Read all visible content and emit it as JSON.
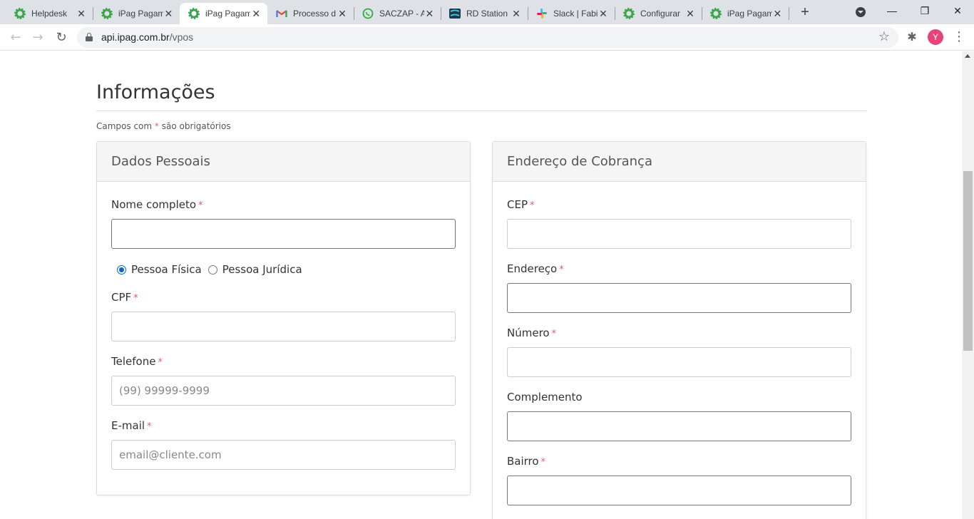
{
  "browser": {
    "tabs": [
      {
        "title": "Helpdesk",
        "icon": "ipag-gear-icon",
        "active": false
      },
      {
        "title": "iPag Pagam",
        "icon": "ipag-gear-icon",
        "active": false
      },
      {
        "title": "iPag Pagam",
        "icon": "ipag-gear-icon",
        "active": true
      },
      {
        "title": "Processo d",
        "icon": "gmail-icon",
        "active": false
      },
      {
        "title": "SACZAP - A",
        "icon": "whatsapp-icon",
        "active": false
      },
      {
        "title": "RD Station",
        "icon": "rd-station-icon",
        "active": false
      },
      {
        "title": "Slack | Fabi",
        "icon": "slack-icon",
        "active": false
      },
      {
        "title": "Configurar",
        "icon": "ipag-gear-icon",
        "active": false
      },
      {
        "title": "iPag Pagam",
        "icon": "ipag-gear-icon",
        "active": false
      }
    ],
    "new_tab": "+",
    "url_host": "api.ipag.com.br",
    "url_path": "/vpos",
    "profile_initial": "Y",
    "profile_color": "#e8437a"
  },
  "page": {
    "title": "Informações",
    "required_note_prefix": "Campos com",
    "required_mark": "*",
    "required_note_suffix": "são obrigatórios"
  },
  "personal": {
    "header": "Dados Pessoais",
    "name_label": "Nome completo",
    "name_value": "",
    "person_types": [
      {
        "label": "Pessoa Física",
        "selected": true
      },
      {
        "label": "Pessoa Jurídica",
        "selected": false
      }
    ],
    "cpf_label": "CPF",
    "cpf_value": "",
    "phone_label": "Telefone",
    "phone_placeholder": "(99) 99999-9999",
    "email_label": "E-mail",
    "email_placeholder": "email@cliente.com"
  },
  "billing": {
    "header": "Endereço de Cobrança",
    "cep_label": "CEP",
    "address_label": "Endereço",
    "number_label": "Número",
    "complement_label": "Complemento",
    "district_label": "Bairro"
  },
  "colors": {
    "required": "#e35d6a",
    "radio_accent": "#0b63ce"
  }
}
